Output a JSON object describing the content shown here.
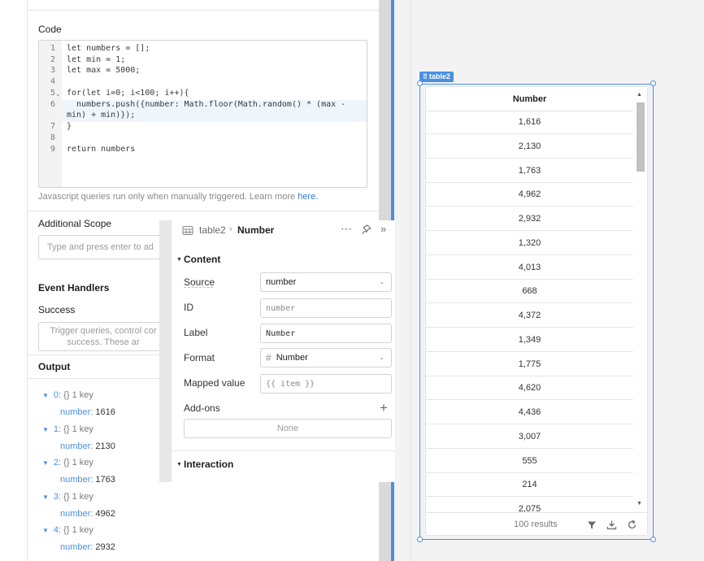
{
  "code_section": {
    "title": "Code",
    "lines": [
      {
        "n": "1",
        "text": "let numbers = [];"
      },
      {
        "n": "2",
        "text": "let min = 1;"
      },
      {
        "n": "3",
        "text": "let max = 5000;"
      },
      {
        "n": "4",
        "text": ""
      },
      {
        "n": "5",
        "text": "for(let i=0; i<100; i++){"
      },
      {
        "n": "6",
        "text": "  numbers.push({number: Math.floor(Math.random() * (max -"
      },
      {
        "n": "",
        "text": "min) + min)});"
      },
      {
        "n": "7",
        "text": "}"
      },
      {
        "n": "8",
        "text": ""
      },
      {
        "n": "9",
        "text": "return numbers"
      }
    ],
    "note_prefix": "Javascript queries run only when manually triggered. Learn more ",
    "note_link": "here."
  },
  "additional_scope": {
    "title": "Additional Scope",
    "placeholder": "Type and press enter to ad"
  },
  "event_handlers": {
    "title": "Event Handlers",
    "success_label": "Success",
    "success_hint_line1": "Trigger queries, control cor",
    "success_hint_line2": "success. These ar"
  },
  "output": {
    "title": "Output",
    "items": [
      {
        "index": "0:",
        "type": "{}",
        "count": "1 key",
        "key": "number:",
        "value": "1616"
      },
      {
        "index": "1:",
        "type": "{}",
        "count": "1 key",
        "key": "number:",
        "value": "2130"
      },
      {
        "index": "2:",
        "type": "{}",
        "count": "1 key",
        "key": "number:",
        "value": "1763"
      },
      {
        "index": "3:",
        "type": "{}",
        "count": "1 key",
        "key": "number:",
        "value": "4962"
      },
      {
        "index": "4:",
        "type": "{}",
        "count": "1 key",
        "key": "number:",
        "value": "2932"
      }
    ]
  },
  "inspector": {
    "breadcrumb_parent": "table2",
    "breadcrumb_child": "Number",
    "content_section": "Content",
    "source_label": "Source",
    "source_value": "number",
    "id_label": "ID",
    "id_value": "number",
    "label_label": "Label",
    "label_value": "Number",
    "format_label": "Format",
    "format_value": "Number",
    "mapped_label": "Mapped value",
    "mapped_value": "{{ item }}",
    "addons_label": "Add-ons",
    "addons_value": "None",
    "interaction_section": "Interaction"
  },
  "canvas": {
    "component_tag": "table2",
    "table": {
      "column_header": "Number",
      "rows": [
        "1,616",
        "2,130",
        "1,763",
        "4,962",
        "2,932",
        "1,320",
        "4,013",
        "668",
        "4,372",
        "1,349",
        "1,775",
        "4,620",
        "4,436",
        "3,007",
        "555",
        "214",
        "2,075"
      ],
      "results_text": "100 results"
    }
  },
  "icons": [
    "table-icon",
    "more-icon",
    "pin-icon",
    "expand-icon",
    "filter-icon",
    "download-icon",
    "refresh-icon",
    "hash-icon",
    "plus-icon"
  ]
}
